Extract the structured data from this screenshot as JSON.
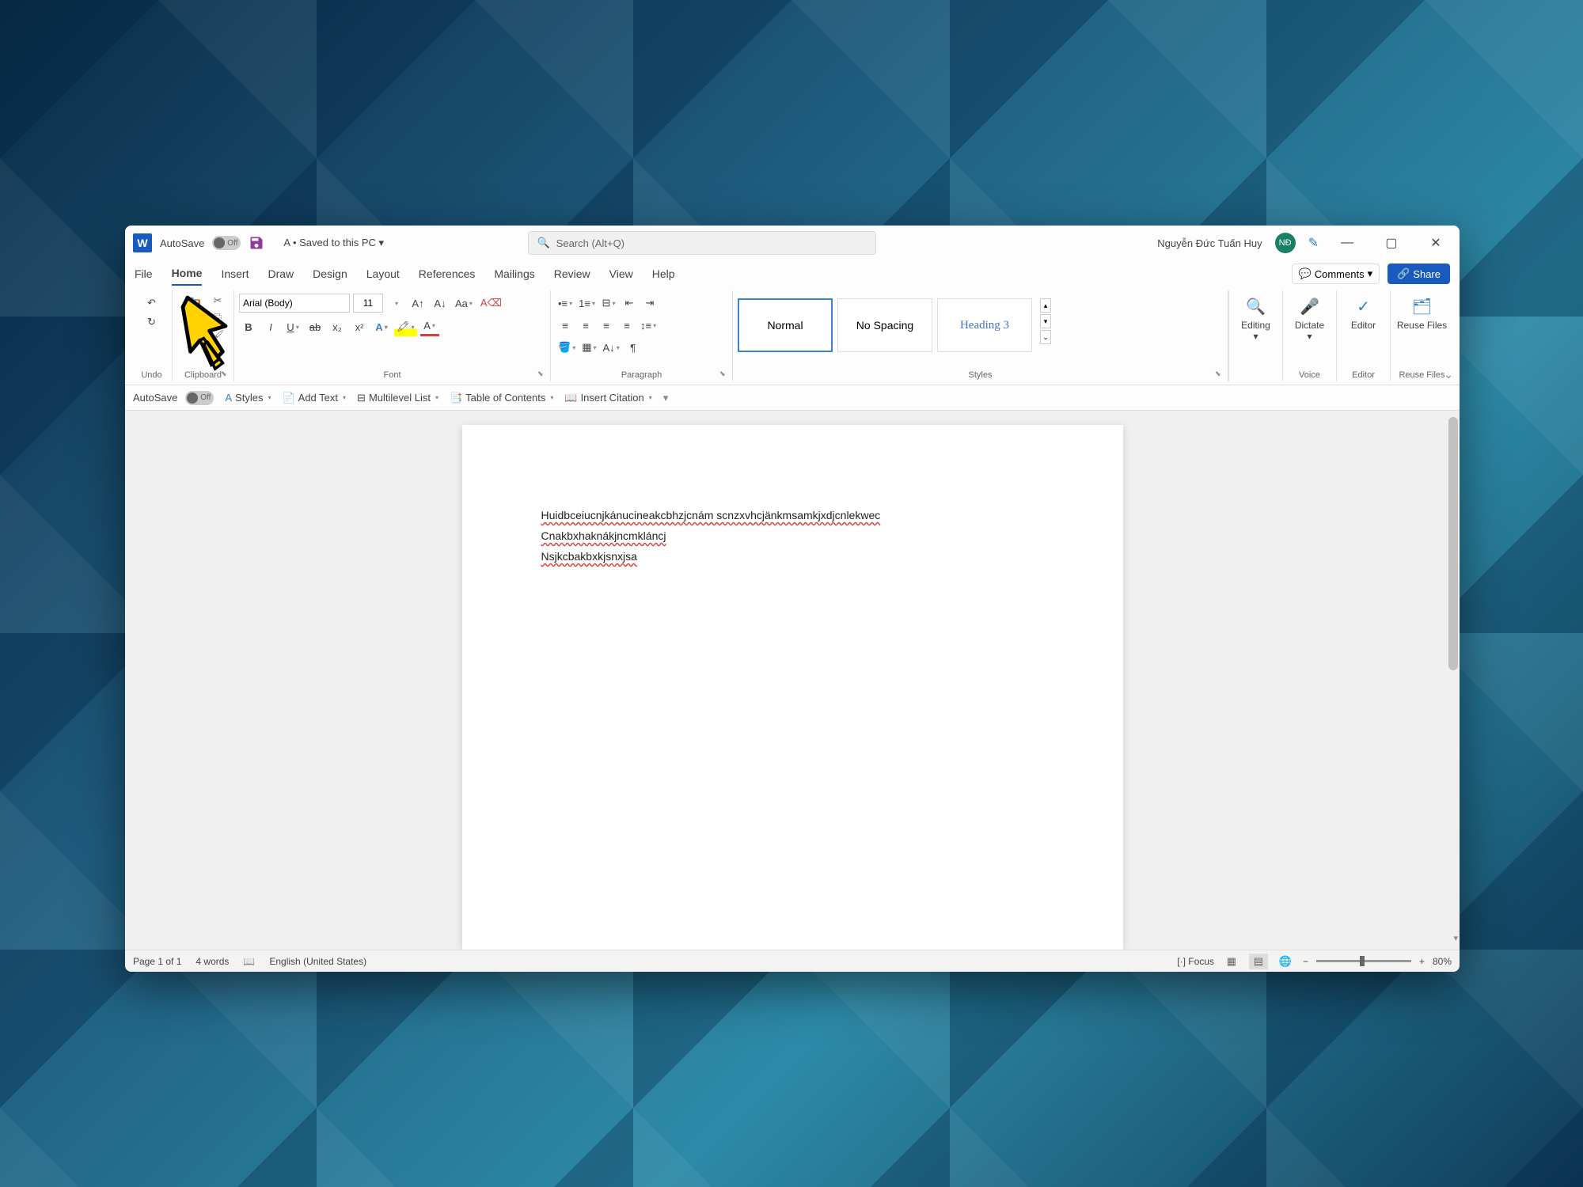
{
  "titlebar": {
    "autosave_label": "AutoSave",
    "autosave_state": "Off",
    "doc_title": "A • Saved to this PC",
    "search_placeholder": "Search (Alt+Q)",
    "user_name": "Nguyễn Đức Tuấn Huy",
    "user_initials": "NĐ"
  },
  "tabs": {
    "items": [
      "File",
      "Home",
      "Insert",
      "Draw",
      "Design",
      "Layout",
      "References",
      "Mailings",
      "Review",
      "View",
      "Help"
    ],
    "active": "Home",
    "comments": "Comments",
    "share": "Share"
  },
  "ribbon": {
    "undo_label": "Undo",
    "clipboard_label": "Clipboard",
    "font_label": "Font",
    "font_name": "Arial (Body)",
    "font_size": "11",
    "paragraph_label": "Paragraph",
    "styles_label": "Styles",
    "styles": [
      "Normal",
      "No Spacing",
      "Heading 3"
    ],
    "editing": "Editing",
    "dictate": "Dictate",
    "editor": "Editor",
    "reuse": "Reuse Files",
    "voice_label": "Voice",
    "editor_label": "Editor",
    "reuse_label": "Reuse Files"
  },
  "qat": {
    "autosave": "AutoSave",
    "autosave_state": "Off",
    "styles": "Styles",
    "add_text": "Add Text",
    "multilevel": "Multilevel List",
    "toc": "Table of Contents",
    "citation": "Insert Citation"
  },
  "document": {
    "lines": [
      "Huidbceiucnjkánucineakcbhzjcnám scnzxvhcjänkmsamkjxdjcnlekwec",
      "Cnakbxhaknákjncmkláncj",
      "Nsjkcbakbxkjsnxjsa"
    ]
  },
  "statusbar": {
    "page": "Page 1 of 1",
    "words": "4 words",
    "language": "English (United States)",
    "focus": "Focus",
    "zoom": "80%"
  }
}
